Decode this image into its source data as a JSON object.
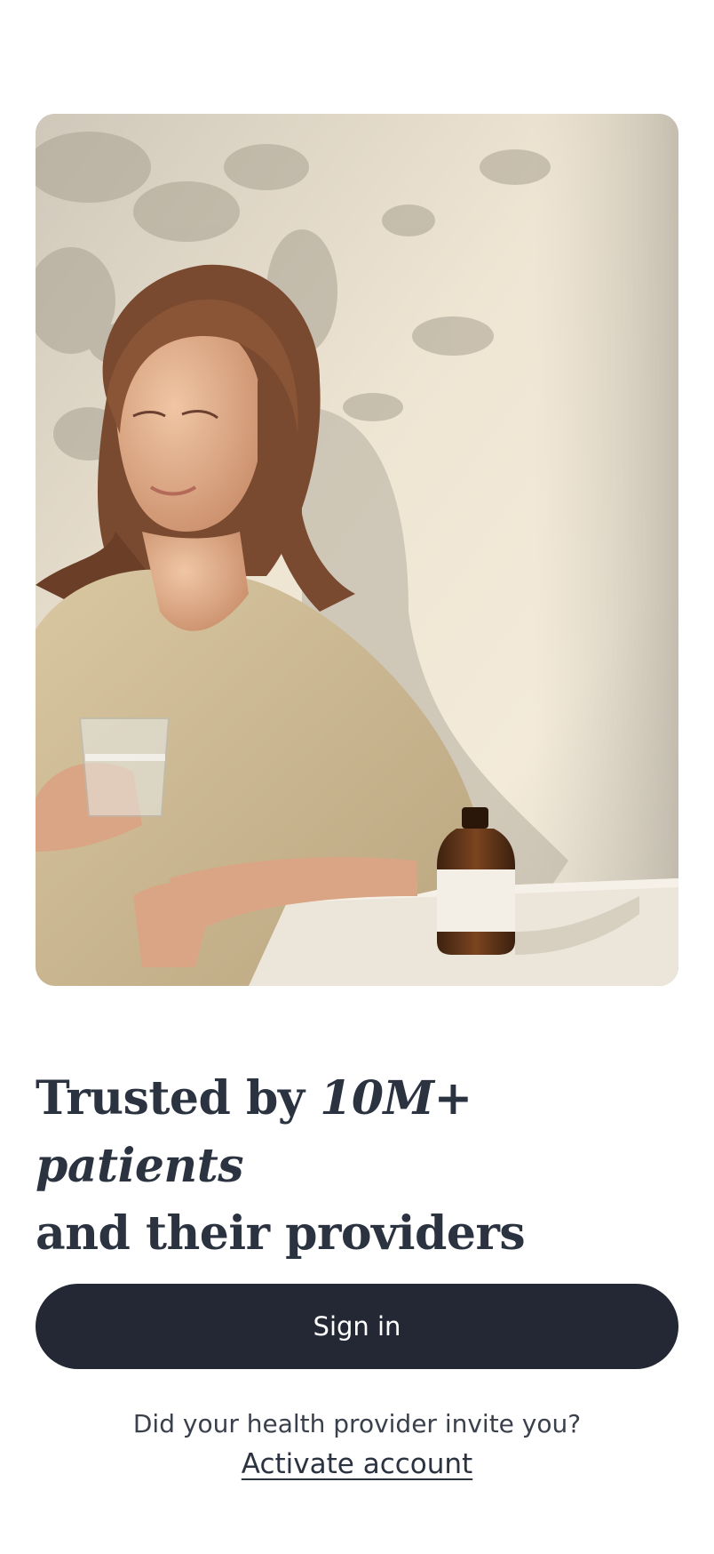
{
  "hero": {
    "image_subject": "woman-holding-water-glass-with-amber-bottle"
  },
  "headline": {
    "plain_1": "Trusted by ",
    "emphasis": "10M+ patients",
    "plain_2": "and their providers"
  },
  "actions": {
    "signin_label": "Sign in",
    "invite_question": "Did your health provider invite you?",
    "activate_label": "Activate account"
  },
  "colors": {
    "button_bg": "#232834",
    "text_primary": "#2b3240",
    "background": "#ffffff"
  }
}
